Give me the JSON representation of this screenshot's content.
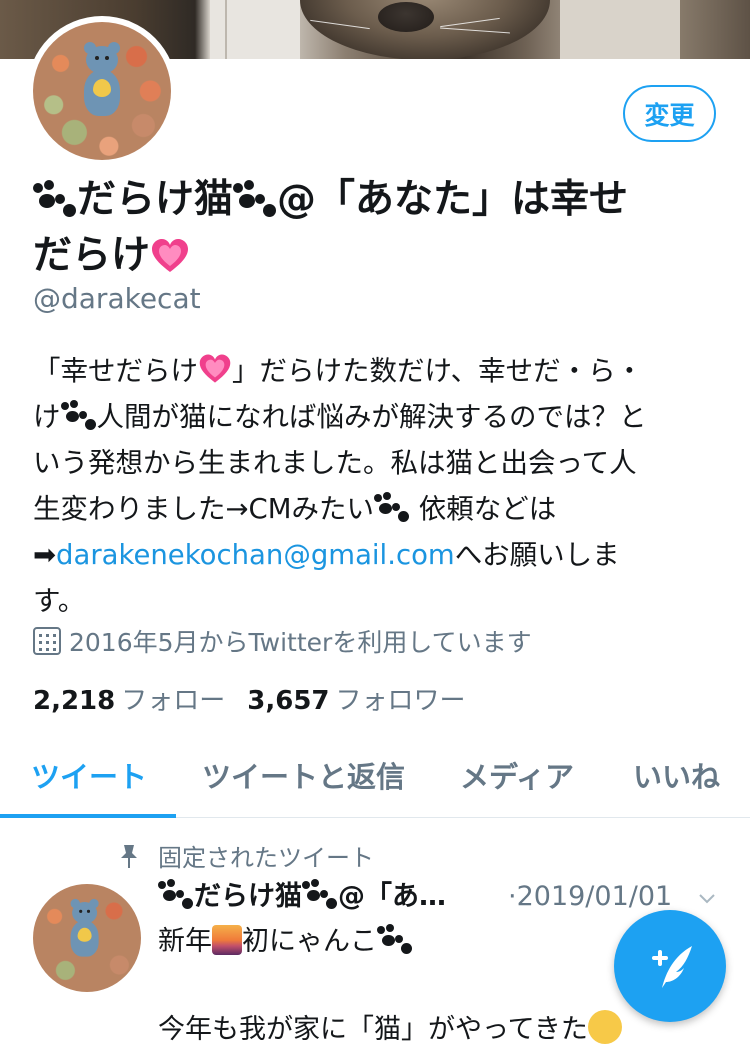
{
  "profile": {
    "edit_label": "変更",
    "name_part1": "だらけ猫",
    "name_part2": "@「あなた」は幸せ",
    "name_part3": "だらけ",
    "handle": "@darakecat",
    "bio": {
      "line1a": "「幸せだらけ",
      "line1b": "」だらけた数だけ、幸せだ・ら・",
      "line2a": "け",
      "line2b": "人間が猫になれば悩みが解決するのでは？と",
      "line3": "いう発想から生まれました。私は猫と出会って人",
      "line4a": "生変わりました→CMみたい",
      "line4b": " 依頼などは",
      "line5_arrow": "➡",
      "email": "darakenekochan@gmail.com",
      "line5b": "へお願いしま",
      "line6": "す。"
    },
    "joined": "2016年5月からTwitterを利用しています",
    "following_count": "2,218",
    "following_label": "フォロー",
    "followers_count": "3,657",
    "followers_label": "フォロワー"
  },
  "tabs": [
    {
      "label": "ツイート",
      "active": true
    },
    {
      "label": "ツイートと返信",
      "active": false
    },
    {
      "label": "メディア",
      "active": false
    },
    {
      "label": "いいね",
      "active": false
    }
  ],
  "pinned": {
    "label": "固定されたツイート",
    "name": "だらけ猫",
    "name_rest": "@「あ…",
    "date": "·2019/01/01",
    "body_1a": "新年",
    "body_1b": "初にゃんこ",
    "body_3": "今年も我が家に「猫」がやってきた"
  },
  "colors": {
    "accent": "#1da1f2",
    "link": "#1b95e0",
    "secondary_text": "#657786"
  },
  "icons": [
    "paw-icon",
    "sparkling-heart-icon",
    "calendar-icon",
    "pin-icon",
    "chevron-down-icon",
    "compose-tweet-icon",
    "sunrise-icon",
    "smile-icon"
  ]
}
